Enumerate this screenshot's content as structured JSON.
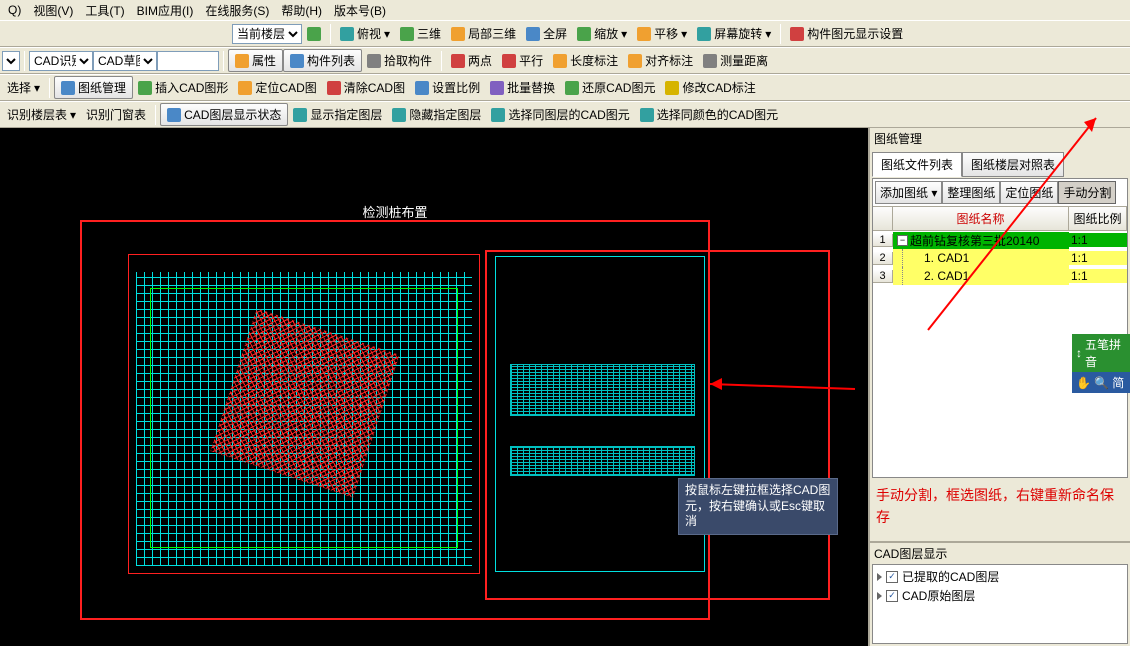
{
  "menu": {
    "items": [
      "Q)",
      "视图(V)",
      "工具(T)",
      "BIM应用(I)",
      "在线服务(S)",
      "帮助(H)",
      "版本号(B)"
    ]
  },
  "row1": {
    "floor_combo": "当前楼层",
    "view_top": "俯视",
    "view_3d": "三维",
    "view_partial3d": "局部三维",
    "view_full": "全屏",
    "zoom": "缩放",
    "pan": "平移",
    "screen_rotate": "屏幕旋转",
    "component_disp": "构件图元显示设置"
  },
  "row2": {
    "cad_recognize": "CAD识别",
    "cad_sketch": "CAD草图",
    "props": "属性",
    "component_list": "构件列表",
    "pick_component": "拾取构件",
    "two_point": "两点",
    "parallel": "平行",
    "length_label": "长度标注",
    "align_label": "对齐标注",
    "measure": "测量距离"
  },
  "row3": {
    "select": "选择",
    "paper_mgr": "图纸管理",
    "insert_cad": "插入CAD图形",
    "locate_cad": "定位CAD图",
    "clear_cad": "清除CAD图",
    "set_scale": "设置比例",
    "batch_replace": "批量替换",
    "restore_cad": "还原CAD图元",
    "fix_label": "修改CAD标注"
  },
  "row4": {
    "recog_floor_tbl": "识别楼层表",
    "recog_door_tbl": "识别门窗表",
    "cad_layer_disp": "CAD图层显示状态",
    "show_layer": "显示指定图层",
    "hide_layer": "隐藏指定图层",
    "select_same_layer": "选择同图层的CAD图元",
    "select_same_color": "选择同颜色的CAD图元"
  },
  "rpanel": {
    "mgr_title": "图纸管理",
    "tab1": "图纸文件列表",
    "tab2": "图纸楼层对照表",
    "tools": {
      "add": "添加图纸",
      "organize": "整理图纸",
      "locate": "定位图纸",
      "manual_split": "手动分割"
    },
    "col_name": "图纸名称",
    "col_scale": "图纸比例",
    "rows": [
      {
        "n": "1",
        "name": "超前钻复核第三批20140",
        "scale": "1:1"
      },
      {
        "n": "2",
        "name": "1. CAD1",
        "scale": "1:1"
      },
      {
        "n": "3",
        "name": "2. CAD1",
        "scale": "1:1"
      }
    ],
    "note": "手动分割，框选图纸，右键重新命名保存",
    "side_badge": {
      "b1": "五笔拼音",
      "b2": "简"
    },
    "layer_title": "CAD图层显示",
    "layer_items": [
      "已提取的CAD图层",
      "CAD原始图层"
    ]
  },
  "canvas": {
    "title": "检测桩布置",
    "tooltip": "按鼠标左键拉框选择CAD图元，按右键确认或Esc键取消"
  }
}
